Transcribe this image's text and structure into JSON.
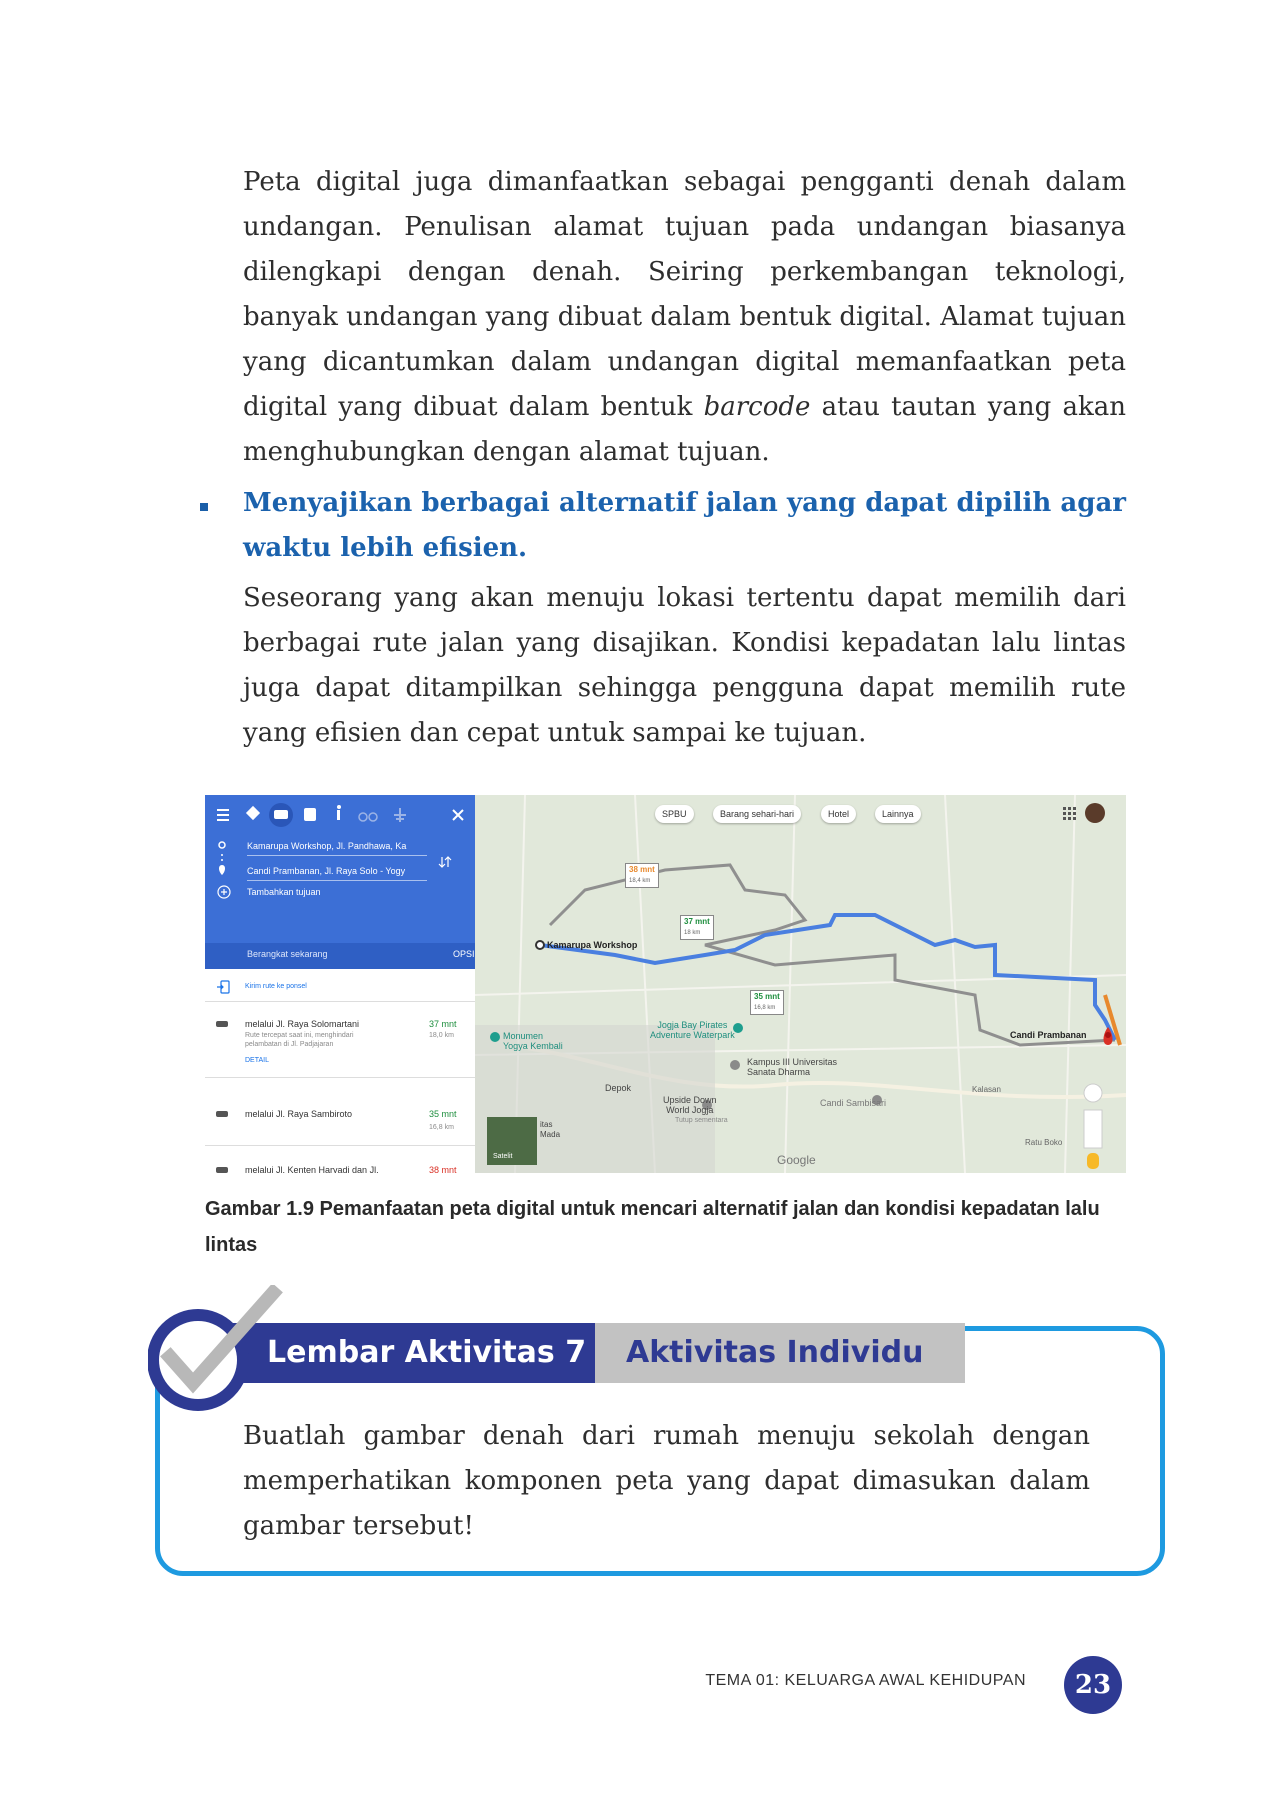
{
  "paragraph1": "Peta digital juga dimanfaatkan sebagai pengganti denah dalam undangan. Penulisan alamat tujuan pada undangan biasanya dilengkapi dengan denah. Seiring perkembangan teknologi, banyak undangan yang dibuat dalam bentuk digital. Alamat tujuan yang dicantumkan dalam undangan digital memanfaatkan peta digital yang dibuat dalam",
  "paragraph1_word_before": "bentuk",
  "paragraph1_italic": "barcode",
  "paragraph1_end": "atau tautan yang akan menghubungkan dengan alamat tujuan.",
  "bullet_heading": "Menyajikan berbagai alternatif jalan yang dapat dipilih agar waktu lebih efisien.",
  "paragraph2": "Seseorang yang akan menuju lokasi tertentu dapat memilih dari berbagai rute jalan yang disajikan. Kondisi kepadatan lalu lintas juga dapat ditampilkan sehingga pengguna dapat memilih rute yang efisien dan cepat untuk sampai ke tujuan.",
  "map": {
    "origin": "Kamarupa Workshop, Jl. Pandhawa, Ka",
    "destination": "Candi Prambanan, Jl. Raya Solo - Yogy",
    "add_destination": "Tambahkan tujuan",
    "depart": "Berangkat sekarang",
    "options": "OPSI",
    "send_phone": "Kirim rute ke ponsel",
    "routes": [
      {
        "via": "melalui Jl. Raya Solomartani",
        "time": "37 mnt",
        "dist": "18,0 km",
        "note1": "Rute tercepat saat ini, menghindari",
        "note2": "pelambatan di Jl. Padjajaran",
        "detail": "DETAIL"
      },
      {
        "via": "melalui Jl. Raya Sambiroto",
        "time": "35 mnt",
        "dist": "16,8 km"
      },
      {
        "via": "melalui Jl. Kenten Haryadi dan Jl.",
        "time": "38 mnt"
      }
    ],
    "chips": [
      "SPBU",
      "Barang sehari-hari",
      "Hotel",
      "Lainnya"
    ],
    "labels": {
      "origin_marker": "Kamarupa Workshop",
      "dest_marker": "Candi Prambanan",
      "monumen": "Monumen\nYogya Kembali",
      "jogja_bay": "Jogja Bay Pirates\nAdventure Waterpark",
      "kampus": "Kampus III Universitas\nSanata Dharma",
      "depok": "Depok",
      "upside": "Upside Down\nWorld Jogja",
      "tutup": "Tutup sementara",
      "sambisari": "Candi Sambisari",
      "kalasan": "Kalasan",
      "ratu_boko": "Ratu Boko",
      "satelit": "Satelit",
      "google": "Google",
      "tas": "itas\nMada"
    },
    "time_boxes": [
      {
        "time": "38 mnt",
        "dist": "18,4 km"
      },
      {
        "time": "37 mnt",
        "dist": "18 km"
      },
      {
        "time": "35 mnt",
        "dist": "16,8 km"
      }
    ]
  },
  "caption": "Gambar 1.9 Pemanfaatan peta digital untuk mencari alternatif jalan dan kondisi kepadatan lalu lintas",
  "activity": {
    "title": "Lembar Aktivitas 7",
    "type": "Aktivitas Individu",
    "text": "Buatlah gambar denah dari rumah menuju sekolah dengan memperhatikan komponen peta yang dapat dimasukan dalam gambar tersebut!"
  },
  "footer": {
    "theme": "TEMA 01: KELUARGA AWAL KEHIDUPAN",
    "page": "23"
  }
}
